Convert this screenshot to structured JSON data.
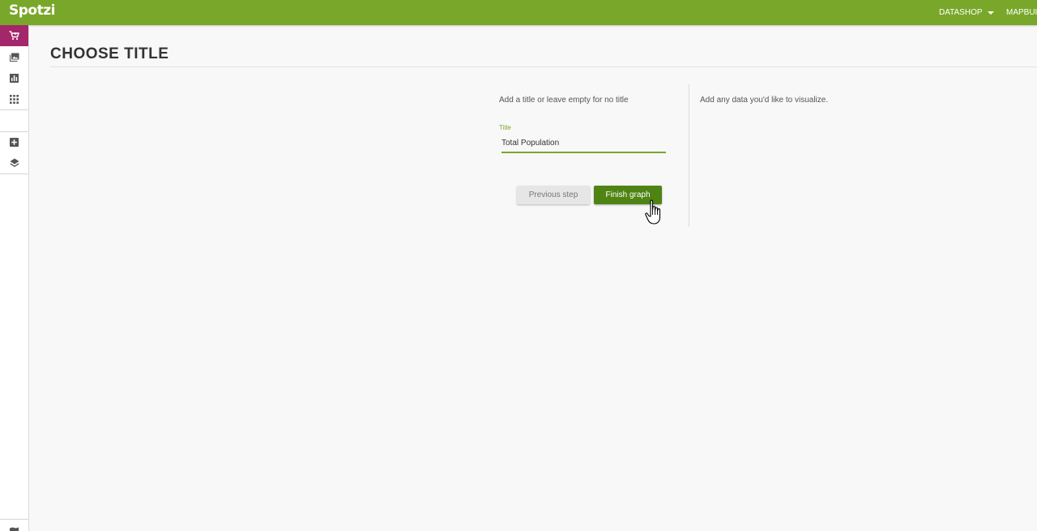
{
  "app": {
    "logo_text": "Spotzi",
    "brand_color": "#79a72a",
    "accent_color": "#a4266b",
    "button_color": "#4f8414"
  },
  "topnav": {
    "datashop": "DATASHOP",
    "mapbuilder": "MAPBUILDER"
  },
  "sidebar": {
    "items": [
      {
        "icon": "cart-icon",
        "active": true
      },
      {
        "icon": "image-icon",
        "active": false
      },
      {
        "icon": "bar-chart-icon",
        "active": false
      },
      {
        "icon": "grid-icon",
        "active": false
      },
      {
        "icon": "add-box-icon",
        "active": false
      },
      {
        "icon": "layers-icon",
        "active": false
      },
      {
        "icon": "map-icon",
        "active": false
      }
    ]
  },
  "main": {
    "title": "CHOOSE TITLE",
    "hint": "Add a title or leave empty for no title",
    "field_label": "Title",
    "title_value": "Total Population",
    "prev_label": "Previous step",
    "finish_label": "Finish graph",
    "data_hint": "Add any data you'd like to visualize."
  }
}
